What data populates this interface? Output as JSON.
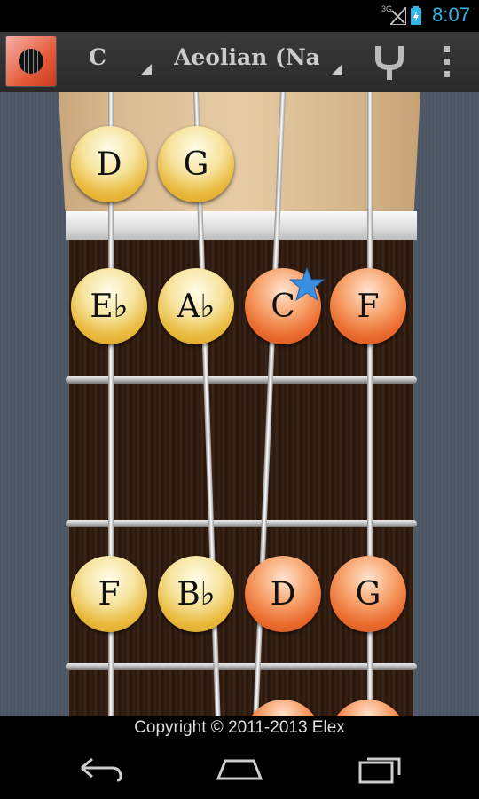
{
  "status_bar": {
    "time": "8:07",
    "network": "3G",
    "icons": [
      "signal-icon",
      "battery-charging-icon"
    ],
    "accent": "#33b5e5"
  },
  "action_bar": {
    "key": "C",
    "mode": "Aeolian (Na",
    "icons": [
      "app-icon",
      "tuner-fork-icon",
      "overflow-menu-icon"
    ]
  },
  "fretboard": {
    "open_row": [
      "D",
      "G"
    ],
    "fret1": [
      "E♭",
      "A♭",
      "C",
      "F"
    ],
    "fret3": [
      "F",
      "B♭",
      "D",
      "G"
    ],
    "root_note": "C",
    "colors": {
      "yellow": "#f6e39d",
      "orange": "#ea6b2e",
      "root_star": "#3b8fe0"
    }
  },
  "footer": {
    "copyright": "Copyright © 2011-2013 Elex"
  },
  "nav_bar": {
    "icons": [
      "back-icon",
      "home-icon",
      "recent-apps-icon"
    ]
  }
}
